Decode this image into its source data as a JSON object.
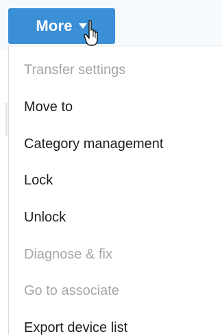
{
  "more_button": {
    "label": "More",
    "background_color": "#3a8fd6",
    "caret_icon": "caret-down-icon",
    "cursor_icon": "hand-pointer-icon"
  },
  "menu": {
    "items": [
      {
        "label": "Transfer settings",
        "enabled": false
      },
      {
        "label": "Move to",
        "enabled": true
      },
      {
        "label": "Category management",
        "enabled": true
      },
      {
        "label": "Lock",
        "enabled": true
      },
      {
        "label": "Unlock",
        "enabled": true
      },
      {
        "label": "Diagnose & fix",
        "enabled": false
      },
      {
        "label": "Go to associate",
        "enabled": false
      },
      {
        "label": "Export device list",
        "enabled": true
      }
    ],
    "enabled_text_color": "#1f1f1f",
    "disabled_text_color": "#a6a6a6"
  }
}
